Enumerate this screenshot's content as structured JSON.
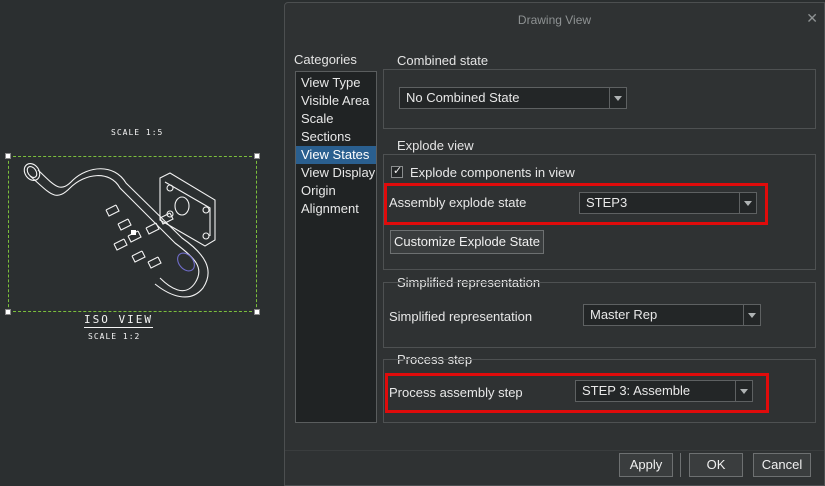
{
  "drawing": {
    "scale_top": "SCALE 1:5",
    "view_name": "ISO VIEW",
    "scale_bottom": "SCALE 1:2"
  },
  "dialog": {
    "title": "Drawing View",
    "close_icon": "close-icon",
    "categories_label": "Categories",
    "categories": [
      "View Type",
      "Visible Area",
      "Scale",
      "Sections",
      "View States",
      "View Display",
      "Origin",
      "Alignment"
    ],
    "selected_category": "View States",
    "combined_state": {
      "title": "Combined state",
      "value": "No Combined State"
    },
    "explode_view": {
      "title": "Explode view",
      "checkbox_label": "Explode components in view",
      "checked": true,
      "state_label": "Assembly explode state",
      "state_value": "STEP3",
      "customize_button": "Customize Explode State"
    },
    "simplified_rep": {
      "title": "Simplified representation",
      "label": "Simplified representation",
      "value": "Master Rep"
    },
    "process_step": {
      "title": "Process step",
      "label": "Process assembly step",
      "value": "STEP 3: Assemble"
    },
    "buttons": {
      "apply": "Apply",
      "ok": "OK",
      "cancel": "Cancel"
    },
    "highlight_color": "#e00b0b",
    "selected_color": "#2a5f8f"
  }
}
